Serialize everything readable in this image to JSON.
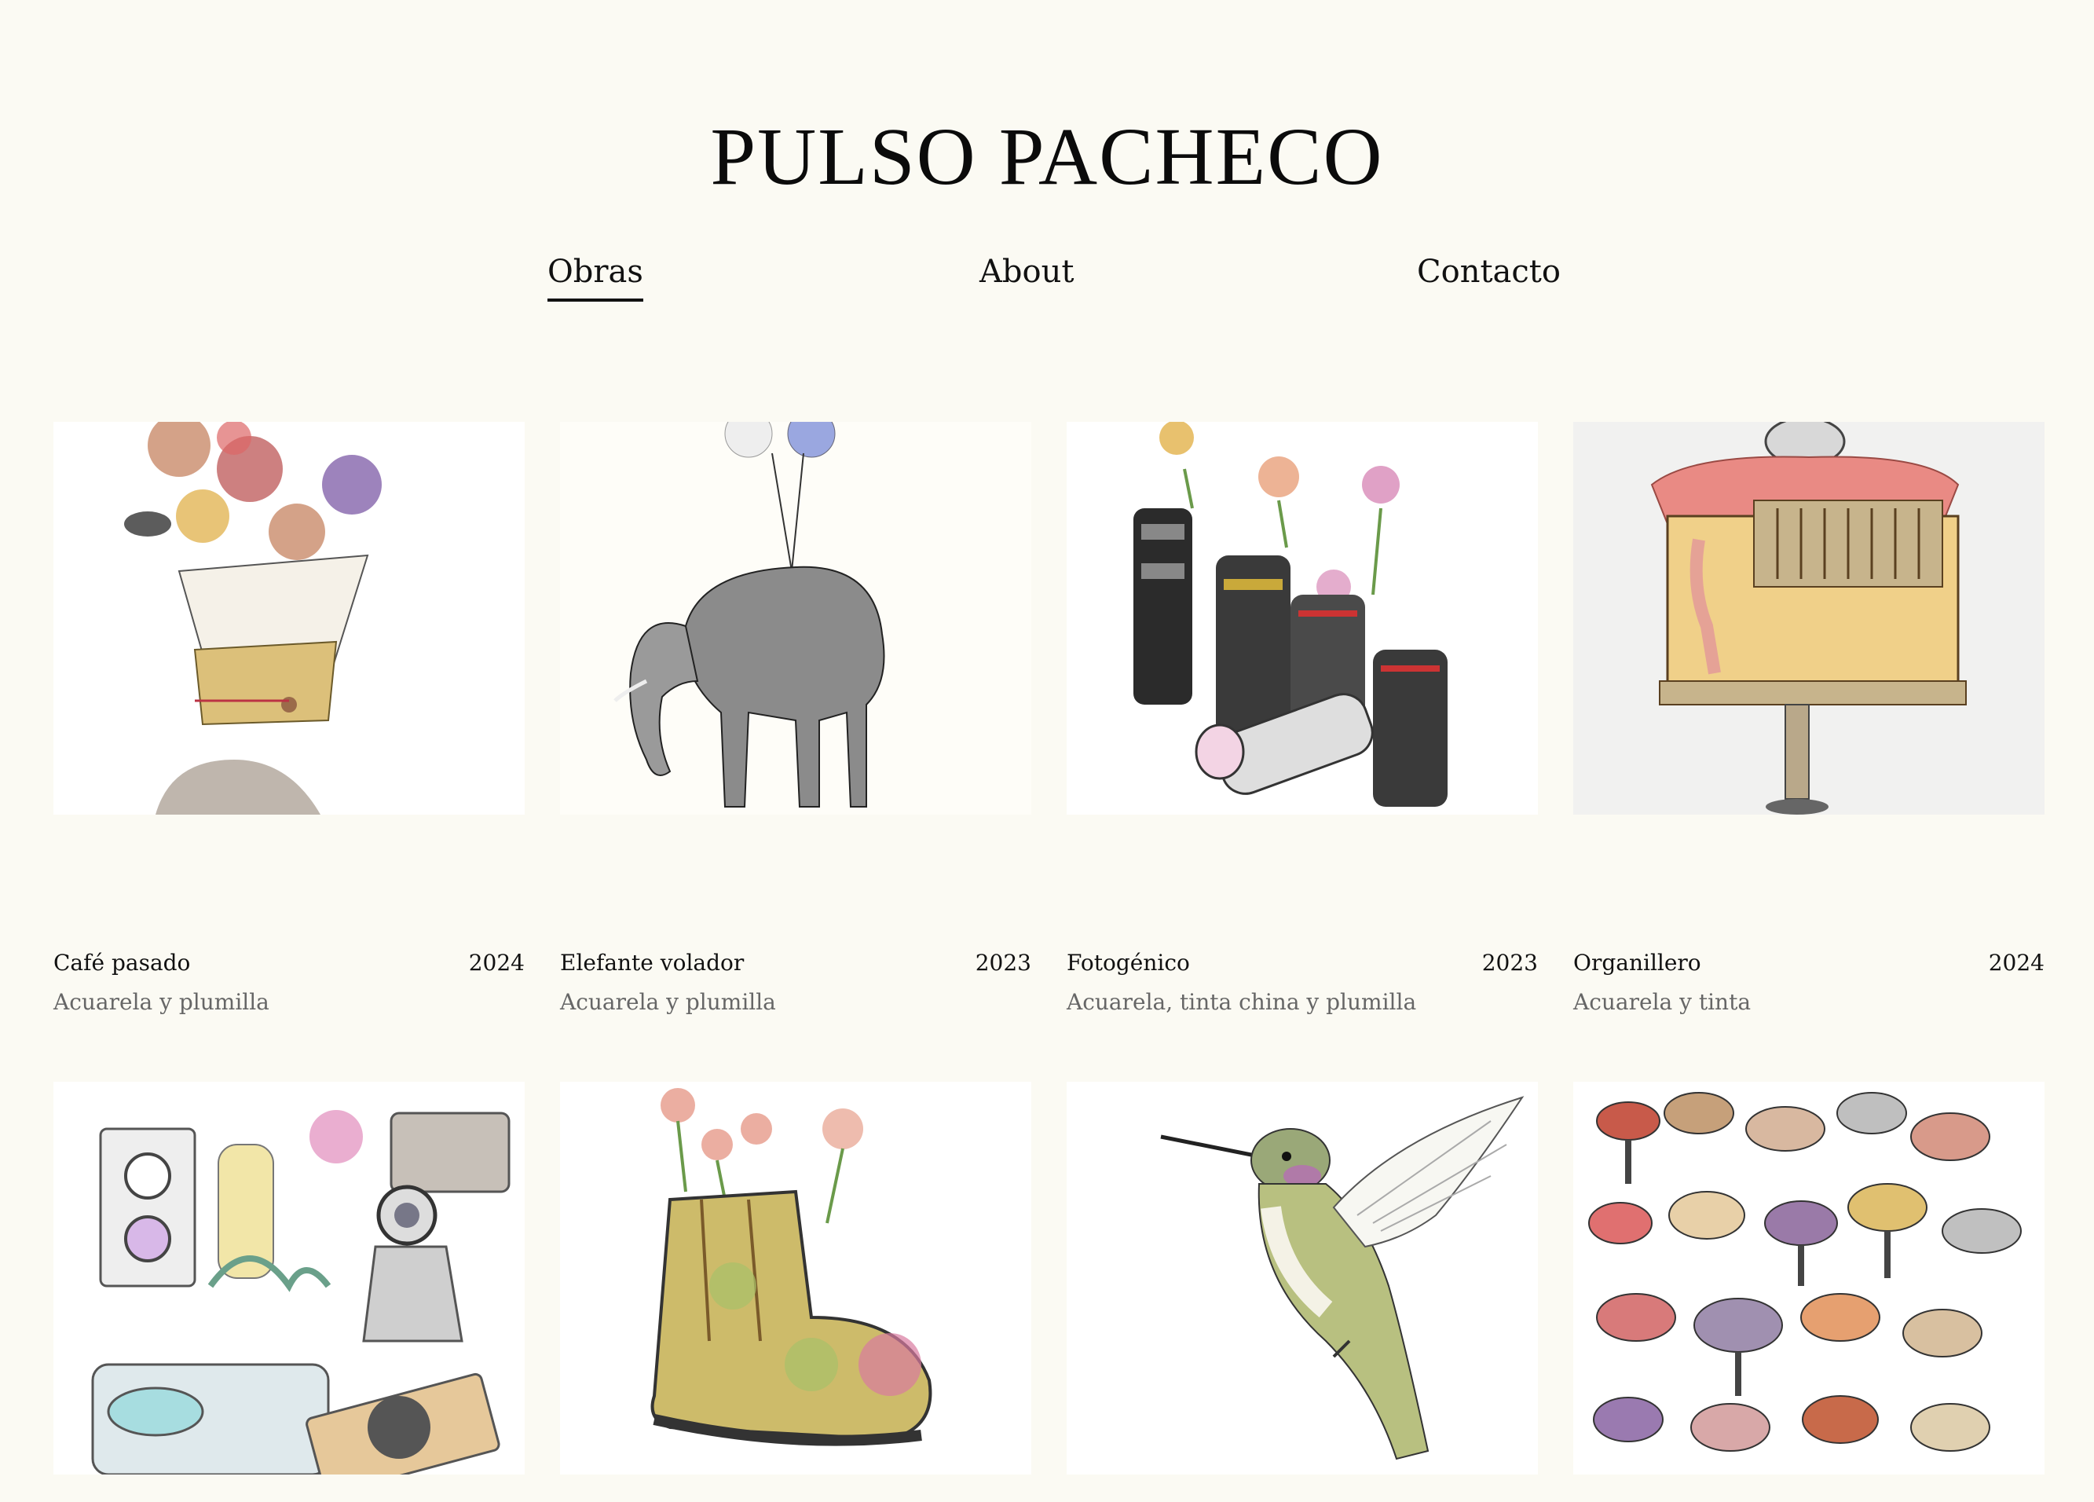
{
  "site": {
    "title": "PULSO PACHECO"
  },
  "nav": {
    "items": [
      {
        "label": "Obras",
        "active": true
      },
      {
        "label": "About",
        "active": false
      },
      {
        "label": "Contacto",
        "active": false
      }
    ]
  },
  "gallery": {
    "works": [
      {
        "title": "Café pasado",
        "year": "2024",
        "medium": "Acuarela y plumilla",
        "image": "coffee-filter-mushroom-bouquet-illustration"
      },
      {
        "title": "Elefante volador",
        "year": "2023",
        "medium": "Acuarela y plumilla",
        "image": "elephant-with-balloons-illustration"
      },
      {
        "title": "Fotogénico",
        "year": "2023",
        "medium": "Acuarela, tinta china y plumilla",
        "image": "camera-lenses-with-flowers-illustration"
      },
      {
        "title": "Organillero",
        "year": "2024",
        "medium": "Acuarela y tinta",
        "image": "barrel-organ-illustration"
      },
      {
        "image": "vintage-cameras-and-typewriter-illustration"
      },
      {
        "image": "boot-with-flowers-illustration"
      },
      {
        "image": "hummingbird-illustration"
      },
      {
        "image": "mushroom-collection-illustration"
      }
    ]
  }
}
